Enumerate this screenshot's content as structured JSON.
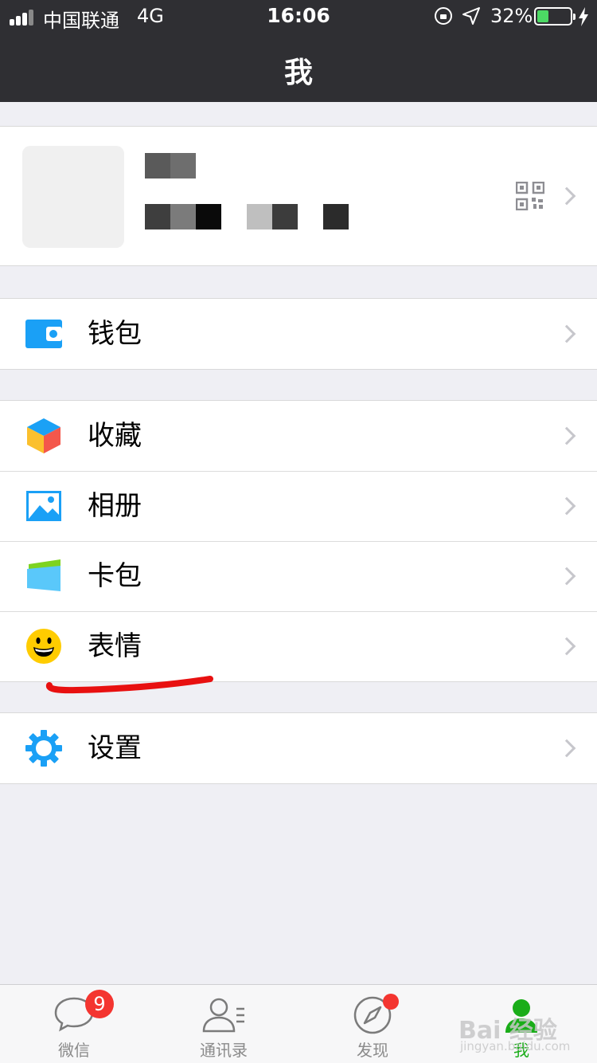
{
  "status_bar": {
    "carrier": "中国联通",
    "network": "4G",
    "time": "16:06",
    "battery": "32%",
    "battery_level": 0.32
  },
  "header": {
    "title": "我"
  },
  "profile": {
    "avatar": "blurred-avatar",
    "qr_icon": "qr-code-icon"
  },
  "groups": [
    {
      "items": [
        {
          "label": "钱包",
          "icon": "wallet-icon",
          "color": "#1aa0f6"
        }
      ]
    },
    {
      "items": [
        {
          "label": "收藏",
          "icon": "favorites-cube-icon",
          "color": "#f6a623"
        },
        {
          "label": "相册",
          "icon": "album-icon",
          "color": "#1aa0f6"
        },
        {
          "label": "卡包",
          "icon": "card-wallet-icon",
          "color": "#5ac8fa"
        },
        {
          "label": "表情",
          "icon": "sticker-smiley-icon",
          "color": "#ffcc00"
        }
      ]
    },
    {
      "items": [
        {
          "label": "设置",
          "icon": "settings-gear-icon",
          "color": "#1aa0f6"
        }
      ]
    }
  ],
  "annotation": {
    "color": "#e81010"
  },
  "tabbar": {
    "tabs": [
      {
        "label": "微信",
        "badge": "9"
      },
      {
        "label": "通讯录"
      },
      {
        "label": "发现"
      },
      {
        "label": "我",
        "active": true
      }
    ],
    "active_color": "#1aad19"
  },
  "watermark": {
    "text": "Bai 经验",
    "sub": "jingyan.baidu.com"
  }
}
